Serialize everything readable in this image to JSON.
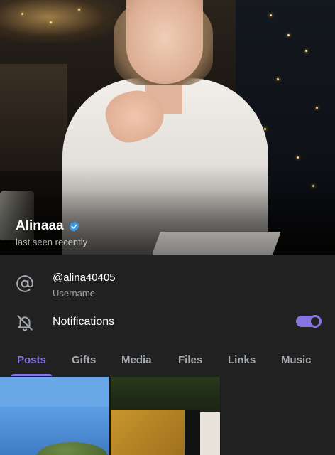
{
  "profile": {
    "name": "Alinaaa",
    "status": "last seen recently",
    "verified_icon": "verified-badge-icon"
  },
  "info": {
    "username_value": "@alina40405",
    "username_label": "Username",
    "username_icon": "at-sign-icon",
    "notifications_label": "Notifications",
    "notifications_icon": "bell-off-icon",
    "notifications_enabled": true
  },
  "tabs": [
    {
      "label": "Posts",
      "active": true
    },
    {
      "label": "Gifts",
      "active": false
    },
    {
      "label": "Media",
      "active": false
    },
    {
      "label": "Files",
      "active": false
    },
    {
      "label": "Links",
      "active": false
    },
    {
      "label": "Music",
      "active": false
    }
  ],
  "colors": {
    "accent": "#8774e1",
    "background": "#212121",
    "secondary_text": "#9ba0a6",
    "verified": "#3a9ae8"
  }
}
